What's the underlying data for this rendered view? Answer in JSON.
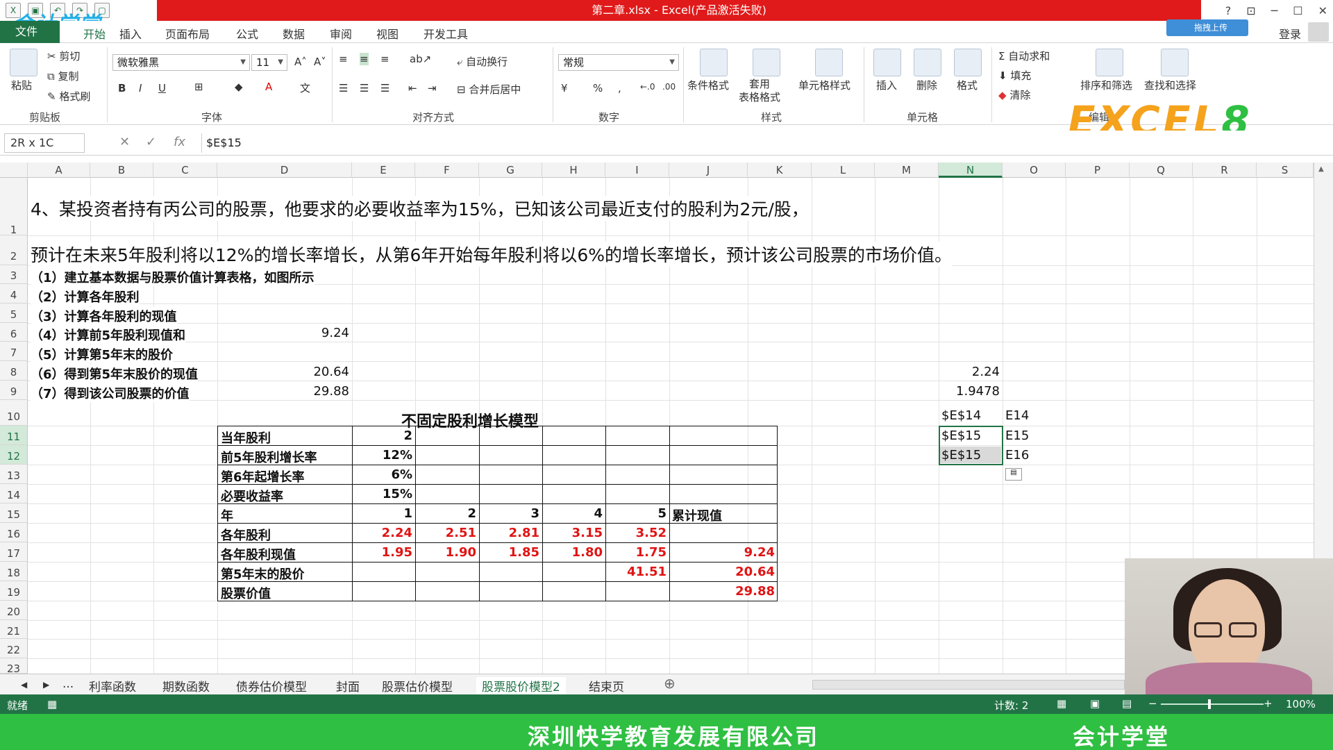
{
  "window": {
    "title": "第二章.xlsx - Excel(产品激活失败)",
    "login": "登录",
    "cloud_button": "拖拽上传",
    "logo_text": "会计学堂"
  },
  "tabs": [
    "文件",
    "开始",
    "插入",
    "页面布局",
    "公式",
    "数据",
    "审阅",
    "视图",
    "开发工具"
  ],
  "ribbon": {
    "clipboard": {
      "paste": "粘贴",
      "cut": "剪切",
      "copy": "复制",
      "format_painter": "格式刷",
      "label": "剪贴板"
    },
    "font": {
      "name": "微软雅黑",
      "size": "11",
      "label": "字体",
      "bold": "B",
      "italic": "I",
      "underline": "U"
    },
    "alignment": {
      "wrap": "自动换行",
      "merge": "合并后居中",
      "label": "对齐方式"
    },
    "number": {
      "format": "常规",
      "label": "数字",
      "percent": "%",
      "comma": ","
    },
    "styles": {
      "conditional": "条件格式",
      "table_format": "套用\n表格格式",
      "cell_styles": "单元格样式",
      "label": "样式"
    },
    "cells": {
      "insert": "插入",
      "delete": "删除",
      "format": "格式",
      "label": "单元格"
    },
    "editing": {
      "autosum": "自动求和",
      "fill": "填充",
      "clear": "清除",
      "sort_filter": "排序和筛选",
      "find_select": "查找和选择",
      "label": "编辑"
    }
  },
  "watermark": {
    "excel": "EXCEL",
    "eight": "8"
  },
  "formula_bar": {
    "name_box": "2R x 1C",
    "fx": "fx",
    "formula": "$E$15"
  },
  "columns": [
    "A",
    "B",
    "C",
    "D",
    "E",
    "F",
    "G",
    "H",
    "I",
    "J",
    "K",
    "L",
    "M",
    "N",
    "O",
    "P",
    "Q",
    "R",
    "S"
  ],
  "rows": [
    "1",
    "2",
    "3",
    "4",
    "5",
    "6",
    "7",
    "8",
    "9",
    "10",
    "11",
    "12",
    "13",
    "14",
    "15",
    "16",
    "17",
    "18",
    "19",
    "20",
    "21",
    "22",
    "23"
  ],
  "sheet": {
    "r1": "4、某投资者持有丙公司的股票，他要求的必要收益率为15%，已知该公司最近支付的股利为2元/股，",
    "r2": "预计在未来5年股利将以12%的增长率增长，从第6年开始每年股利将以6%的增长率增长，预计该公司股票的市场价值。",
    "steps": [
      "（1）建立基本数据与股票价值计算表格，如图所示",
      "（2）计算各年股利",
      "（3）计算各年股利的现值",
      "（4）计算前5年股利现值和",
      "（5）计算第5年末的股价",
      "（6）得到第5年末股价的现值",
      "（7）得到该公司股票的价值"
    ],
    "d6": "9.24",
    "d8": "20.64",
    "d9": "29.88",
    "n8": "2.24",
    "n9": "1.9478",
    "n10": "$E$14",
    "o10": "E14",
    "n11": "$E$15",
    "o11": "E15",
    "n12": "$E$15",
    "o12": "E16",
    "model_title": "不固定股利增长模型",
    "inputs": [
      {
        "label": "当年股利",
        "value": "2"
      },
      {
        "label": "前5年股利增长率",
        "value": "12%"
      },
      {
        "label": "第6年起增长率",
        "value": "6%"
      },
      {
        "label": "必要收益率",
        "value": "15%"
      }
    ],
    "year_label": "年",
    "years": [
      "1",
      "2",
      "3",
      "4",
      "5"
    ],
    "cum_label": "累计现值",
    "dividends_label": "各年股利",
    "dividends": [
      "2.24",
      "2.51",
      "2.81",
      "3.15",
      "3.52"
    ],
    "pv_label": "各年股利现值",
    "pv": [
      "1.95",
      "1.90",
      "1.85",
      "1.80",
      "1.75"
    ],
    "pv_total": "9.24",
    "price5_label": "第5年末的股价",
    "price5": "41.51",
    "price5_pv": "20.64",
    "stock_value_label": "股票价值",
    "stock_value": "29.88"
  },
  "sheet_tabs": [
    "利率函数",
    "期数函数",
    "债券估价模型",
    "封面",
    "股票估价模型",
    "股票股价模型2",
    "结束页"
  ],
  "sheet_nav_more": "...",
  "status": {
    "ready": "就绪",
    "count": "计数: 2",
    "zoom": "100%"
  },
  "footer": {
    "company": "深圳快学教育发展有限公司",
    "brand": "会计学堂"
  }
}
